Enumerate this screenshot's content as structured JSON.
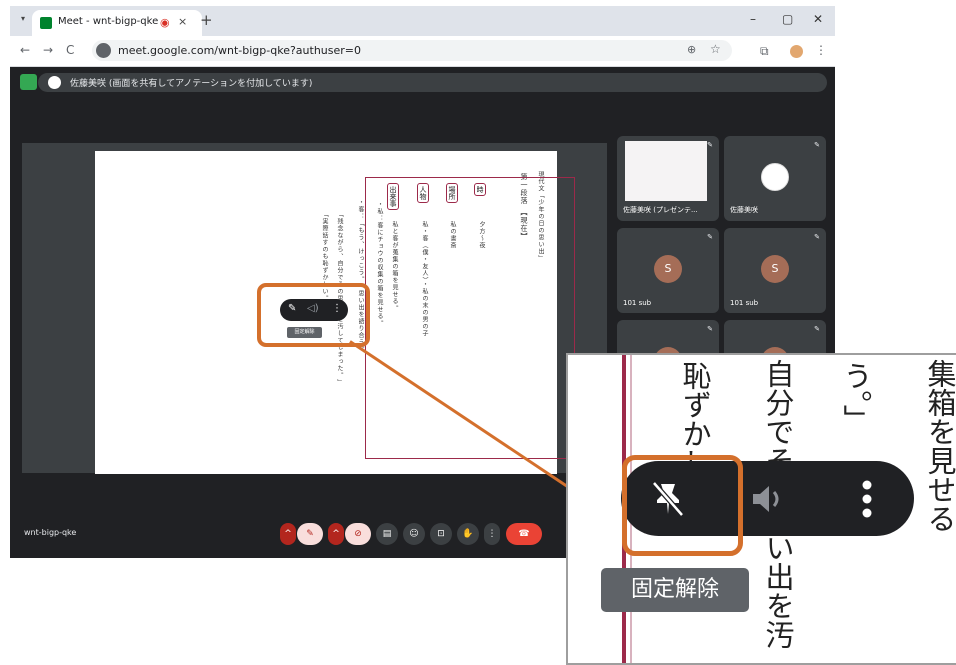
{
  "browser": {
    "tab_title": "Meet - wnt-bigp-qke",
    "tab_close": "×",
    "new_tab": "+",
    "rec_indicator": "◉",
    "tab_dropdown": "▾",
    "min": "–",
    "max": "▢",
    "close": "✕",
    "back": "←",
    "forward": "→",
    "reload": "C",
    "url": "meet.google.com/wnt-bigp-qke?authuser=0",
    "zoom_icon": "⊕",
    "star_icon": "☆",
    "ext_icon": "⧉",
    "menu_icon": "⋮"
  },
  "meet": {
    "share_banner": "佐藤美咲 (画面を共有してアノテーションを付加しています)",
    "meeting_code": "wnt-bigp-qke",
    "tiles": [
      {
        "name": "佐藤美咲 (プレゼンテ...",
        "pin": "✎",
        "type": "thumb"
      },
      {
        "name": "佐藤美咲",
        "pin": "✎",
        "type": "avatar-white",
        "avatar": ""
      },
      {
        "name": "101 sub",
        "pin": "✎",
        "type": "avatar",
        "avatar": "S"
      },
      {
        "name": "101 sub",
        "pin": "✎",
        "type": "avatar",
        "avatar": "S"
      },
      {
        "name": "",
        "pin": "✎",
        "type": "avatar",
        "avatar": ""
      },
      {
        "name": "",
        "pin": "✎",
        "type": "avatar",
        "avatar": ""
      }
    ],
    "hover_controls": {
      "unpin_icon": "✎",
      "audio_icon": "◁)",
      "more_icon": "⋮",
      "tooltip": "固定解除"
    },
    "controls": {
      "caret": "^",
      "mic": "✎",
      "cam": "⊘",
      "captions": "▤",
      "emoji": "☺",
      "present": "⊡",
      "hand": "✋",
      "more": "⋮",
      "end": "☎"
    }
  },
  "slide": {
    "heading": "現代文「少年の日の思い出」",
    "section": "第一段落 【現在】",
    "tags": [
      "時",
      "場所",
      "人物",
      "出来事"
    ],
    "time_value": "夕方〜夜",
    "place_value": "私の書斎",
    "people_value": "私・客（僕・友人）・私の末の男の子",
    "event_line1": "私と客が蒐集の箱を見せる。",
    "event_line2": "・私：客にチョウの収集の箱を見せる。",
    "event_line3": "・客：「もう、けっこう。」思い出を語り合う。",
    "event_line4": "「残念ながら、自分でその思い出を汚してしまった。」",
    "event_line5": "「実際話すのも恥ずかしい。」"
  },
  "inset": {
    "col1": "集箱を見せる",
    "col2": "う。」",
    "col3": "自分でその思い出を汚",
    "col4": "恥ずかしい」",
    "tooltip": "固定解除"
  }
}
